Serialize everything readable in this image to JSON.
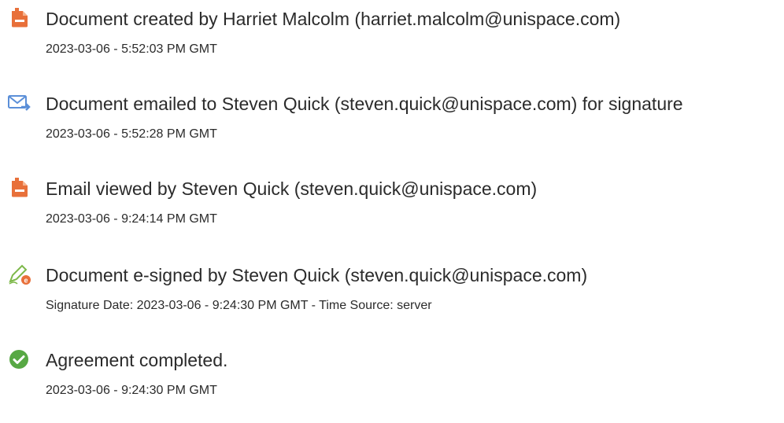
{
  "colors": {
    "doc_icon": "#E8703A",
    "mail_icon": "#5B8FD8",
    "esign_icon": "#7DB84A",
    "complete_icon": "#57A844"
  },
  "events": [
    {
      "icon": "document-icon",
      "title": "Document created by Harriet Malcolm (harriet.malcolm@unispace.com)",
      "detail": "2023-03-06 - 5:52:03 PM GMT"
    },
    {
      "icon": "email-send-icon",
      "title": "Document emailed to Steven Quick (steven.quick@unispace.com) for signature",
      "detail": "2023-03-06 - 5:52:28 PM GMT"
    },
    {
      "icon": "document-icon",
      "title": "Email viewed by Steven Quick (steven.quick@unispace.com)",
      "detail": "2023-03-06 - 9:24:14 PM GMT"
    },
    {
      "icon": "esign-pen-icon",
      "title": "Document e-signed by Steven Quick (steven.quick@unispace.com)",
      "detail": "Signature Date: 2023-03-06 - 9:24:30 PM GMT - Time Source: server"
    },
    {
      "icon": "check-circle-icon",
      "title": "Agreement completed.",
      "detail": "2023-03-06 - 9:24:30 PM GMT"
    }
  ]
}
